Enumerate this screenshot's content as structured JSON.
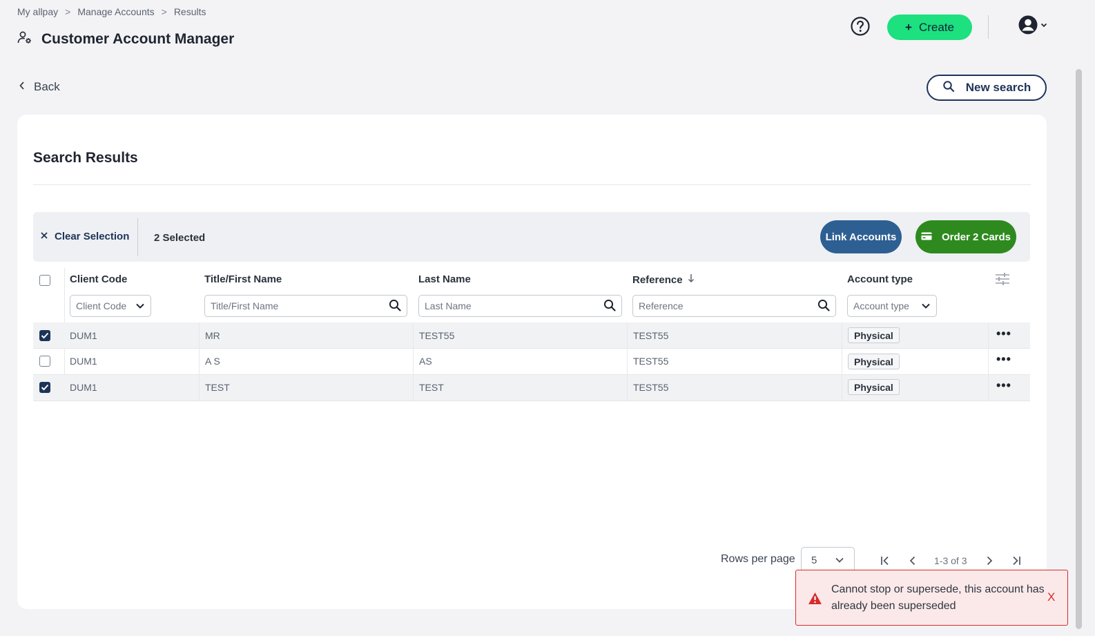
{
  "breadcrumb": [
    "My allpay",
    "Manage Accounts",
    "Results"
  ],
  "breadcrumb_sep": ">",
  "page_title": "Customer Account Manager",
  "header": {
    "create_label": "Create"
  },
  "back_label": "Back",
  "new_search_label": "New search",
  "section_title": "Search Results",
  "selection": {
    "clear_label": "Clear Selection",
    "count_label": "2 Selected",
    "link_label": "Link Accounts",
    "order_label": "Order 2 Cards"
  },
  "columns": {
    "client_code": "Client Code",
    "first_name": "Title/First Name",
    "last_name": "Last Name",
    "reference": "Reference",
    "account_type": "Account type"
  },
  "filters": {
    "client_code": "Client Code",
    "first_name": "Title/First Name",
    "last_name": "Last Name",
    "reference": "Reference",
    "account_type": "Account type"
  },
  "rows": [
    {
      "checked": true,
      "client_code": "DUM1",
      "first_name": "MR",
      "last_name": "TEST55",
      "reference": "TEST55",
      "account_type": "Physical"
    },
    {
      "checked": false,
      "client_code": "DUM1",
      "first_name": "A S",
      "last_name": "AS",
      "reference": "TEST55",
      "account_type": "Physical"
    },
    {
      "checked": true,
      "client_code": "DUM1",
      "first_name": "TEST",
      "last_name": "TEST",
      "reference": "TEST55",
      "account_type": "Physical"
    }
  ],
  "more_label": "•••",
  "pagination": {
    "rows_per_page_label": "Rows per page",
    "rows_per_page": "5",
    "range": "1-3 of 3"
  },
  "toast": {
    "message": "Cannot stop or supersede, this account has already been superseded",
    "close_label": "X"
  },
  "colors": {
    "accent_green": "#1de07f",
    "navy": "#1c3458",
    "link_blue": "#2e5f93",
    "order_green": "#2e8a1f",
    "error_red": "#d62b2b"
  }
}
